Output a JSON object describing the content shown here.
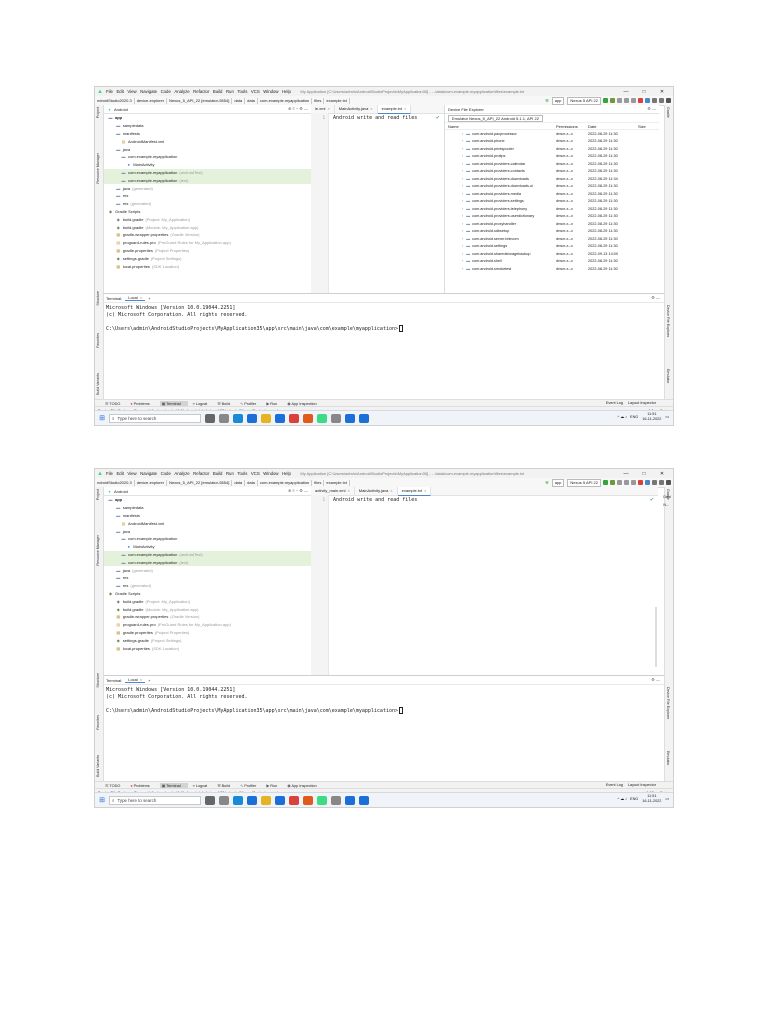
{
  "screens": [
    {
      "title_bar": {
        "menu": [
          "File",
          "Edit",
          "View",
          "Navigate",
          "Code",
          "Analyze",
          "Refactor",
          "Build",
          "Run",
          "Tools",
          "VCS",
          "Window",
          "Help"
        ],
        "window_title": "My Application [C:\\Users\\admin\\AndroidStudioProjects\\MyApplication35] - ...\\data\\com.example.myapplication\\files\\example.txt"
      },
      "nav_bar": {
        "breadcrumbs": [
          "ndroidStudio2020.3",
          "device-explorer",
          "Nexus_5_API_22 [emulator-5554]",
          "data",
          "data",
          "com.example.myapplication",
          "files",
          "example.txt"
        ],
        "run_config": "app",
        "device": "Nexus 5 API 22"
      },
      "project": {
        "view": "Android",
        "tree": [
          {
            "text": "app",
            "icon": "folder",
            "hint": ""
          },
          {
            "text": "sampledata",
            "icon": "folder",
            "hint": ""
          },
          {
            "text": "manifests",
            "icon": "folder",
            "hint": ""
          },
          {
            "text": "AndroidManifest.xml",
            "icon": "file",
            "hint": ""
          },
          {
            "text": "java",
            "icon": "folder",
            "hint": ""
          },
          {
            "text": "com.example.myapplication",
            "icon": "folder",
            "hint": ""
          },
          {
            "text": "MainActivity",
            "icon": "class",
            "hint": ""
          },
          {
            "text": "com.example.myapplication",
            "icon": "folder",
            "hint": "(androidTest)"
          },
          {
            "text": "com.example.myapplication",
            "icon": "folder",
            "hint": "(test)"
          },
          {
            "text": "java",
            "icon": "folder",
            "hint": "(generated)"
          },
          {
            "text": "res",
            "icon": "folder",
            "hint": ""
          },
          {
            "text": "res",
            "icon": "folder",
            "hint": "(generated)"
          },
          {
            "text": "Gradle Scripts",
            "icon": "gradle",
            "hint": ""
          },
          {
            "text": "build.gradle",
            "icon": "gradle",
            "hint": "(Project: My_Application)"
          },
          {
            "text": "build.gradle",
            "icon": "gradle",
            "hint": "(Module: My_Application.app)"
          },
          {
            "text": "gradle-wrapper.properties",
            "icon": "props",
            "hint": "(Gradle Version)"
          },
          {
            "text": "proguard-rules.pro",
            "icon": "file",
            "hint": "(ProGuard Rules for My_Application.app)"
          },
          {
            "text": "gradle.properties",
            "icon": "props",
            "hint": "(Project Properties)"
          },
          {
            "text": "settings.gradle",
            "icon": "gradle",
            "hint": "(Project Settings)"
          },
          {
            "text": "local.properties",
            "icon": "props",
            "hint": "(SDK Location)"
          }
        ]
      },
      "editor": {
        "tabs": [
          "le.xml",
          "MainActivity.java",
          "example.txt"
        ],
        "line_number": "1",
        "code_line": "Android write and read files"
      },
      "device_explorer": {
        "title": "Device File Explorer",
        "device": "Emulator Nexus_5_API_22 Android 5.1.1, API 22",
        "columns": [
          "Name",
          "Permissions",
          "Date",
          "Size"
        ],
        "rows": [
          {
            "name": "com.android.pacprocessor",
            "perm": "drwxr-x--x",
            "date": "2022-08-29 11:30"
          },
          {
            "name": "com.android.phone",
            "perm": "drwxr-x--x",
            "date": "2022-08-29 11:30"
          },
          {
            "name": "com.android.printspooler",
            "perm": "drwxr-x--x",
            "date": "2022-08-29 11:30"
          },
          {
            "name": "com.android.protips",
            "perm": "drwxr-x--x",
            "date": "2022-08-29 11:30"
          },
          {
            "name": "com.android.providers.calendar",
            "perm": "drwxr-x--x",
            "date": "2022-08-29 11:30"
          },
          {
            "name": "com.android.providers.contacts",
            "perm": "drwxr-x--x",
            "date": "2022-08-29 11:30"
          },
          {
            "name": "com.android.providers.downloads",
            "perm": "drwxr-x--x",
            "date": "2022-08-29 11:34"
          },
          {
            "name": "com.android.providers.downloads.ui",
            "perm": "drwxr-x--x",
            "date": "2022-08-29 11:30"
          },
          {
            "name": "com.android.providers.media",
            "perm": "drwxr-x--x",
            "date": "2022-08-29 11:30"
          },
          {
            "name": "com.android.providers.settings",
            "perm": "drwxr-x--x",
            "date": "2022-08-29 11:30"
          },
          {
            "name": "com.android.providers.telephony",
            "perm": "drwxr-x--x",
            "date": "2022-08-29 11:30"
          },
          {
            "name": "com.android.providers.userdictionary",
            "perm": "drwxr-x--x",
            "date": "2022-08-29 11:30"
          },
          {
            "name": "com.android.proxyhandler",
            "perm": "drwxr-x--x",
            "date": "2022-08-29 11:30"
          },
          {
            "name": "com.android.sdksetup",
            "perm": "drwxr-x--x",
            "date": "2022-08-29 11:30"
          },
          {
            "name": "com.android.server.telecom",
            "perm": "drwxr-x--x",
            "date": "2022-08-29 11:30"
          },
          {
            "name": "com.android.settings",
            "perm": "drwxr-x--x",
            "date": "2022-08-29 11:30"
          },
          {
            "name": "com.android.sharedstoragebackup",
            "perm": "drwxr-x--x",
            "date": "2022-09-13 14:00"
          },
          {
            "name": "com.android.shell",
            "perm": "drwxr-x--x",
            "date": "2022-08-29 11:30"
          },
          {
            "name": "com.android.smoketest",
            "perm": "drwxr-x--x",
            "date": "2022-08-29 11:30"
          }
        ]
      },
      "terminal": {
        "label": "Terminal:",
        "tab": "Local",
        "lines": [
          "Microsoft Windows [Version 10.0.19044.2251]",
          "(c) Microsoft Corporation. All rights reserved.",
          "",
          "C:\\Users\\admin\\AndroidStudioProjects\\MyApplication35\\app\\src\\main\\java\\com\\example\\myapplication>"
        ]
      },
      "tool_windows": [
        "TODO",
        "Problems",
        "Terminal",
        "Logcat",
        "Build",
        "Profiler",
        "Run",
        "App Inspection"
      ],
      "tool_windows_right": [
        "Event Log",
        "Layout Inspector"
      ],
      "status_text": "Device File Explorer: Successfully downloaded 1 file for a total of size of 28 bytes in 54 ms. (3 minutes ago)",
      "status_position": "1:1",
      "side_labels_left": [
        "Project",
        "Resource Manager",
        "Structure",
        "Favorites",
        "Build Variants"
      ],
      "side_labels_right": [
        "Gradle",
        "Device File Explorer",
        "Emulator"
      ],
      "taskbar": {
        "search_placeholder": "Type here to search",
        "time": "11:51",
        "date": "16-11-2022",
        "lang": "ENG"
      }
    },
    {
      "title_bar": {
        "menu": [
          "File",
          "Edit",
          "View",
          "Navigate",
          "Code",
          "Analyze",
          "Refactor",
          "Build",
          "Run",
          "Tools",
          "VCS",
          "Window",
          "Help"
        ],
        "window_title": "My Application [C:\\Users\\admin\\AndroidStudioProjects\\MyApplication35] - ...\\data\\com.example.myapplication\\files\\example.txt"
      },
      "nav_bar": {
        "breadcrumbs": [
          "ndroidStudio2020.3",
          "device-explorer",
          "Nexus_5_API_22 [emulator-5554]",
          "data",
          "data",
          "com.example.myapplication",
          "files",
          "example.txt"
        ],
        "run_config": "app",
        "device": "Nexus 5 API 22"
      },
      "project": {
        "view": "Android",
        "tree": [
          {
            "text": "app",
            "icon": "folder",
            "hint": ""
          },
          {
            "text": "sampledata",
            "icon": "folder",
            "hint": ""
          },
          {
            "text": "manifests",
            "icon": "folder",
            "hint": ""
          },
          {
            "text": "AndroidManifest.xml",
            "icon": "file",
            "hint": ""
          },
          {
            "text": "java",
            "icon": "folder",
            "hint": ""
          },
          {
            "text": "com.example.myapplication",
            "icon": "folder",
            "hint": ""
          },
          {
            "text": "MainActivity",
            "icon": "class",
            "hint": ""
          },
          {
            "text": "com.example.myapplication",
            "icon": "folder",
            "hint": "(androidTest)"
          },
          {
            "text": "com.example.myapplication",
            "icon": "folder",
            "hint": "(test)"
          },
          {
            "text": "java",
            "icon": "folder",
            "hint": "(generated)"
          },
          {
            "text": "res",
            "icon": "folder",
            "hint": ""
          },
          {
            "text": "res",
            "icon": "folder",
            "hint": "(generated)"
          },
          {
            "text": "Gradle Scripts",
            "icon": "gradle",
            "hint": ""
          },
          {
            "text": "build.gradle",
            "icon": "gradle",
            "hint": "(Project: My_Application)"
          },
          {
            "text": "build.gradle",
            "icon": "gradle",
            "hint": "(Module: My_Application.app)"
          },
          {
            "text": "gradle-wrapper.properties",
            "icon": "props",
            "hint": "(Gradle Version)"
          },
          {
            "text": "proguard-rules.pro",
            "icon": "file",
            "hint": "(ProGuard Rules for My_Application.app)"
          },
          {
            "text": "gradle.properties",
            "icon": "props",
            "hint": "(Project Properties)"
          },
          {
            "text": "settings.gradle",
            "icon": "gradle",
            "hint": "(Project Settings)"
          },
          {
            "text": "local.properties",
            "icon": "props",
            "hint": "(SDK Location)"
          }
        ]
      },
      "editor": {
        "tabs": [
          "activity_main.xml",
          "MainActivity.java",
          "example.txt"
        ],
        "line_number": "1",
        "code_line": "Android write and read files"
      },
      "terminal": {
        "label": "Terminal:",
        "tab": "Local",
        "lines": [
          "Microsoft Windows [Version 10.0.19044.2251]",
          "(c) Microsoft Corporation. All rights reserved.",
          "",
          "C:\\Users\\admin\\AndroidStudioProjects\\MyApplication35\\app\\src\\main\\java\\com\\example\\myapplication>"
        ]
      },
      "tool_windows": [
        "TODO",
        "Problems",
        "Terminal",
        "Logcat",
        "Build",
        "Profiler",
        "Run",
        "App Inspection"
      ],
      "tool_windows_right": [
        "Event Log",
        "Layout Inspector"
      ],
      "status_text": "Device File Explorer: Successfully downloaded 1 file for a total of size of 28 bytes in 54 ms. (3 minutes ago)",
      "status_position": "1:17",
      "side_labels_left": [
        "Project",
        "Resource Manager",
        "Structure",
        "Favorites",
        "Build Variants"
      ],
      "side_labels_right": [
        "Gradle",
        "Device File Explorer",
        "Emulator"
      ],
      "right_strip_extra": [
        "Devi",
        "N..."
      ],
      "taskbar": {
        "search_placeholder": "Type here to search",
        "time": "11:51",
        "date": "16-11-2022",
        "lang": "ENG"
      }
    }
  ],
  "colors": {
    "accent": "#4a88c7",
    "highlight_row": "#e4f2dc",
    "check": "#59a869",
    "windows_blue": "#1b6fd6"
  }
}
